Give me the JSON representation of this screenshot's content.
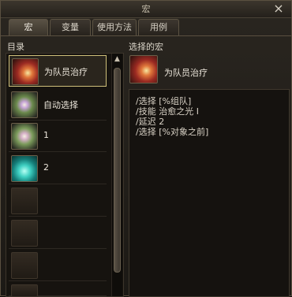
{
  "window": {
    "title": "宏",
    "close_label": "×"
  },
  "tabs": [
    {
      "label": "宏",
      "active": true
    },
    {
      "label": "变量",
      "active": false
    },
    {
      "label": "使用方法",
      "active": false
    },
    {
      "label": "用例",
      "active": false
    }
  ],
  "list": {
    "heading": "目录",
    "items": [
      {
        "label": "为队员治疗",
        "icon": "heal-spell-icon",
        "selected": true
      },
      {
        "label": "自动选择",
        "icon": "star-spell-icon",
        "selected": false
      },
      {
        "label": "1",
        "icon": "star-spell-icon",
        "selected": false
      },
      {
        "label": "2",
        "icon": "teal-spell-icon",
        "selected": false
      },
      {
        "label": "",
        "icon": "empty-slot-icon",
        "selected": false
      },
      {
        "label": "",
        "icon": "empty-slot-icon",
        "selected": false
      },
      {
        "label": "",
        "icon": "empty-slot-icon",
        "selected": false
      },
      {
        "label": "",
        "icon": "empty-slot-icon",
        "selected": false
      }
    ],
    "scroll_up_glyph": "▲"
  },
  "selected_macro": {
    "heading": "选择的宏",
    "name": "为队员治疗",
    "icon": "heal-spell-icon",
    "lines": [
      "/选择 [%组队]",
      "/技能 治愈之光 I",
      "/延迟 2",
      "/选择 [%对象之前]"
    ]
  }
}
